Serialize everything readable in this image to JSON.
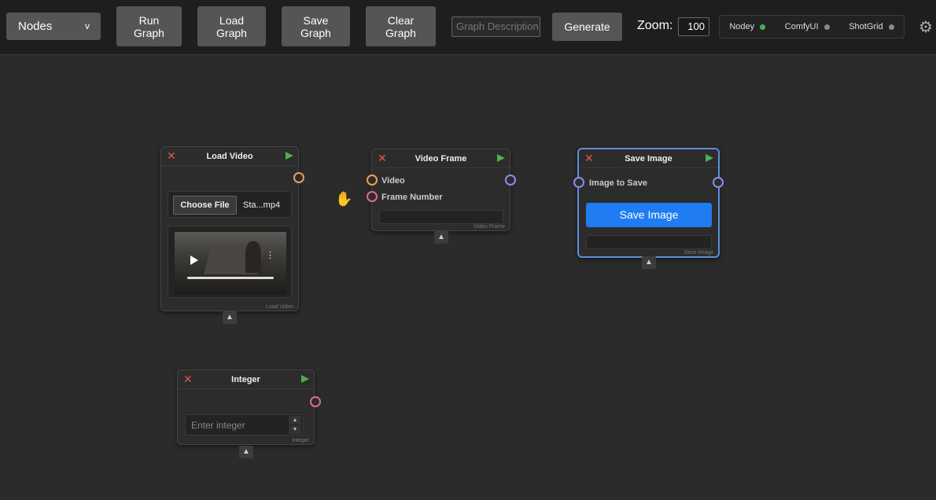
{
  "toolbar": {
    "nodes_select": "Nodes",
    "nodes_caret": "v",
    "run_graph": "Run\nGraph",
    "load_graph": "Load\nGraph",
    "save_graph": "Save\nGraph",
    "clear_graph": "Clear\nGraph",
    "description_placeholder": "Graph Description",
    "generate": "Generate",
    "zoom_label": "Zoom:",
    "zoom_value": "100"
  },
  "status": [
    {
      "label": "Nodey",
      "color": "#4caf50"
    },
    {
      "label": "ComfyUI",
      "color": "#888888"
    },
    {
      "label": "ShotGrid",
      "color": "#888888"
    }
  ],
  "nodes": {
    "load_video": {
      "title": "Load Video",
      "choose_file": "Choose File",
      "file_name": "Sta...mp4",
      "footer": "Load Video"
    },
    "video_frame": {
      "title": "Video Frame",
      "input_video": "Video",
      "input_frame": "Frame Number",
      "footer": "Video Frame"
    },
    "save_image": {
      "title": "Save Image",
      "input_image": "Image to Save",
      "button": "Save Image",
      "footer": "Save Image"
    },
    "integer": {
      "title": "Integer",
      "placeholder": "Enter integer",
      "footer": "Integer"
    }
  },
  "icons": {
    "close": "✕",
    "collapse": "▲",
    "gear": "⚙",
    "spin_up": "▲",
    "spin_down": "▼"
  },
  "colors": {
    "port_orange": "#e8a060",
    "port_purple": "#8c8cf0",
    "port_pink": "#e06b8a",
    "accent_blue": "#1f7cf2"
  }
}
